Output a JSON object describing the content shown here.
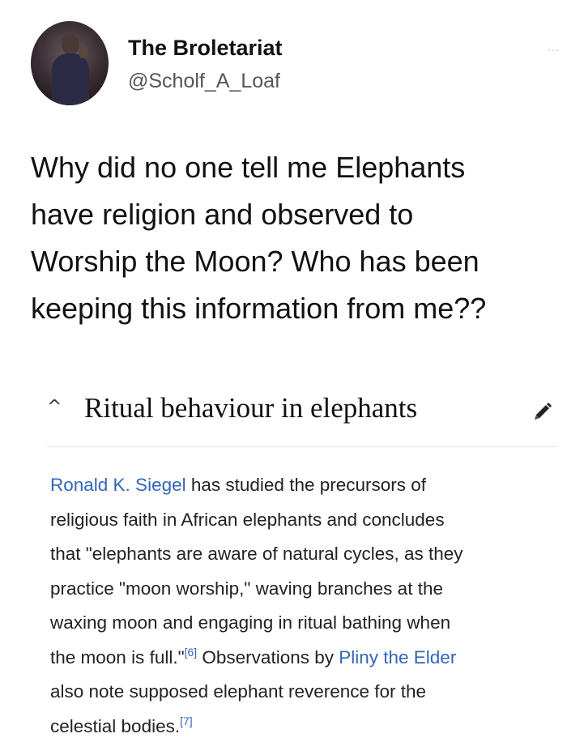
{
  "header": {
    "display_name": "The Broletariat",
    "handle": "@Scholf_A_Loaf",
    "avatar_icon": "profile-photo",
    "more_label": "..."
  },
  "tweet": {
    "lines": [
      "Why did no one tell me Elephants",
      "have religion and observed to",
      "Worship the Moon? Who has been",
      "keeping this information from me??"
    ]
  },
  "section": {
    "collapse_icon": "chevron-up-icon",
    "title": "Ritual behaviour in elephants",
    "edit_icon": "pencil-icon"
  },
  "article": {
    "link_siegel": "Ronald K. Siegel",
    "l1_rest": " has studied the precursors of",
    "l2": "religious faith in African elephants and concludes",
    "l3": "that \"elephants are aware of natural cycles, as they",
    "l4": "practice \"moon worship,\" waving branches at the",
    "l5": "waxing moon and engaging in ritual bathing when",
    "l6_a": "the moon is full.\"",
    "ref6": "[6]",
    "l6_b": " Observations by ",
    "link_pliny": "Pliny the Elder",
    "l7": "also note supposed elephant reverence for the",
    "l8": "celestial bodies.",
    "ref7": "[7]"
  },
  "colors": {
    "link": "#3366b8",
    "text": "#111111",
    "divider": "#e3e3e3"
  }
}
